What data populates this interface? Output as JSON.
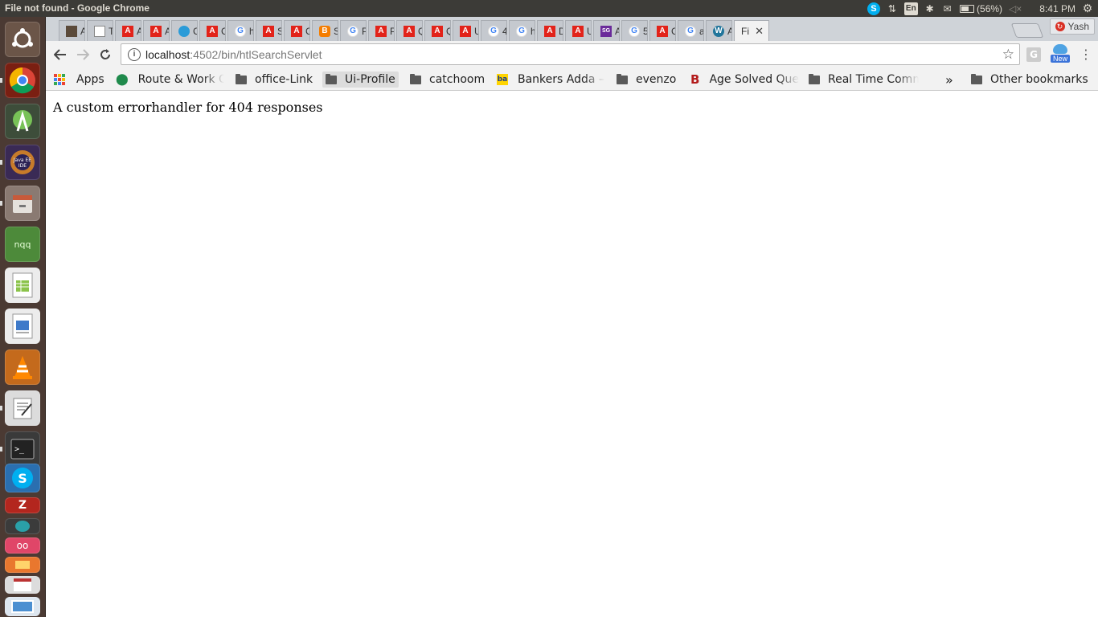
{
  "window": {
    "title": "File not found - Google Chrome"
  },
  "system_tray": {
    "keyboard_layout": "En",
    "battery": "(56%)",
    "clock": "8:41 PM"
  },
  "launcher": {
    "apps": [
      "ubuntu-dash",
      "chrome",
      "android-studio",
      "java-ee-ide",
      "files",
      "nqq",
      "libreoffice-calc",
      "libreoffice-impress",
      "vlc",
      "text-editor",
      "terminal",
      "skype",
      "filezilla",
      "app-orange",
      "app-red",
      "app-calendar",
      "app-remote"
    ]
  },
  "tabs": [
    {
      "label": "A",
      "icon": "dark-square-icon",
      "color": "#5b4a3a"
    },
    {
      "label": "T",
      "icon": "document-icon",
      "color": "#888888"
    },
    {
      "label": "A",
      "icon": "adobe-icon",
      "color": "#e2231a"
    },
    {
      "label": "A",
      "icon": "adobe-icon",
      "color": "#e2231a"
    },
    {
      "label": "C",
      "icon": "bird-icon",
      "color": "#2a9bd8"
    },
    {
      "label": "C",
      "icon": "adobe-icon",
      "color": "#e2231a"
    },
    {
      "label": "h",
      "icon": "google-icon",
      "color": "#4285f4"
    },
    {
      "label": "S",
      "icon": "adobe-icon",
      "color": "#e2231a"
    },
    {
      "label": "C",
      "icon": "adobe-icon",
      "color": "#e2231a"
    },
    {
      "label": "S",
      "icon": "blogger-icon",
      "color": "#f57d00"
    },
    {
      "label": "P",
      "icon": "google-icon",
      "color": "#4285f4"
    },
    {
      "label": "P",
      "icon": "adobe-icon",
      "color": "#e2231a"
    },
    {
      "label": "Q",
      "icon": "adobe-icon",
      "color": "#e2231a"
    },
    {
      "label": "Q",
      "icon": "adobe-icon",
      "color": "#e2231a"
    },
    {
      "label": "U",
      "icon": "adobe-icon",
      "color": "#e2231a"
    },
    {
      "label": "4",
      "icon": "google-icon",
      "color": "#4285f4"
    },
    {
      "label": "h",
      "icon": "google-icon",
      "color": "#4285f4"
    },
    {
      "label": "D",
      "icon": "adobe-icon",
      "color": "#e2231a"
    },
    {
      "label": "U",
      "icon": "adobe-icon",
      "color": "#e2231a"
    },
    {
      "label": "A",
      "icon": "sg-icon",
      "color": "#6a2a9a"
    },
    {
      "label": "5",
      "icon": "google-icon",
      "color": "#4285f4"
    },
    {
      "label": "C",
      "icon": "adobe-icon",
      "color": "#e2231a"
    },
    {
      "label": "a",
      "icon": "google-icon",
      "color": "#4285f4"
    },
    {
      "label": "A",
      "icon": "wordpress-icon",
      "color": "#21759b"
    },
    {
      "label": "Fi",
      "icon": "none",
      "color": "#ffffff",
      "active": true
    }
  ],
  "profile": {
    "name": "Yash"
  },
  "toolbar": {
    "url_host": "localhost",
    "url_path": ":4502/bin/htlSearchServlet",
    "extension_badge": "New",
    "extension_g": "G"
  },
  "bookmarks": {
    "apps_label": "Apps",
    "items": [
      {
        "label": "Route & Work O",
        "icon": "location-pin-icon"
      },
      {
        "label": "office-Link",
        "icon": "folder-icon"
      },
      {
        "label": "Ui-Profile",
        "icon": "folder-icon"
      },
      {
        "label": "catchoom",
        "icon": "folder-icon"
      },
      {
        "label": "Bankers Adda –",
        "icon": "ba-icon"
      },
      {
        "label": "evenzo",
        "icon": "folder-icon"
      },
      {
        "label": "Age Solved Que",
        "icon": "b-icon"
      },
      {
        "label": "Real Time Comm",
        "icon": "folder-icon"
      }
    ],
    "overflow_label": "»",
    "other_label": "Other bookmarks"
  },
  "page": {
    "message": "A custom errorhandler for 404 responses"
  }
}
